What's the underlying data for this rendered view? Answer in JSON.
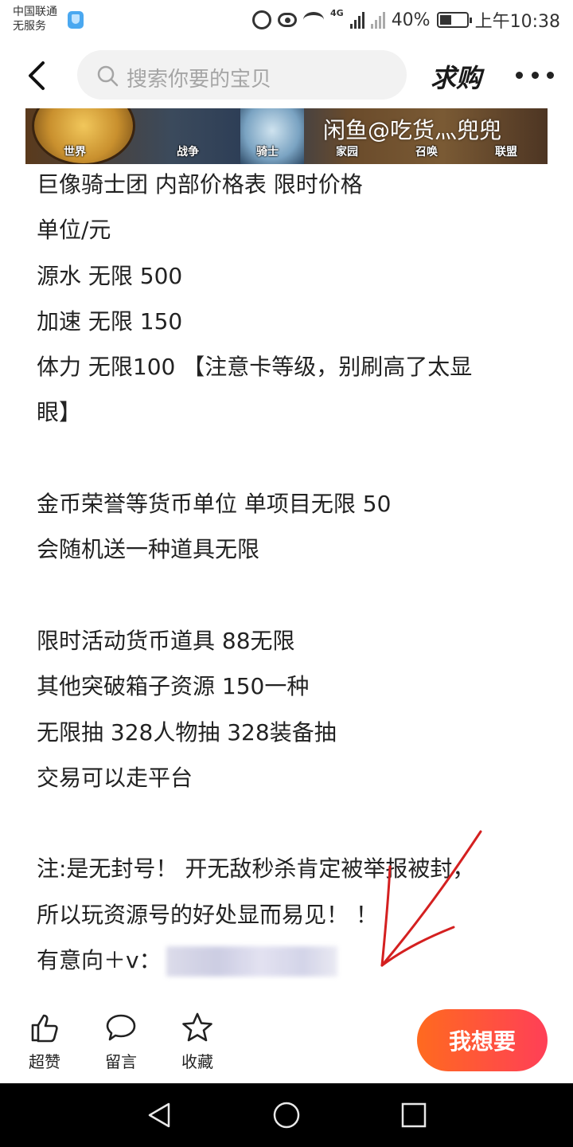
{
  "status_bar": {
    "carrier_line1": "中国联通",
    "carrier_line2": "无服务",
    "network": "4G",
    "battery": "40%",
    "time": "上午10:38"
  },
  "nav": {
    "search_placeholder": "搜索你要的宝贝",
    "want_buy_label": "求购"
  },
  "banner": {
    "tabs": [
      "世界",
      "战争",
      "骑士",
      "家园",
      "召唤",
      "联盟"
    ],
    "watermark": "闲鱼@吃货灬兜兜"
  },
  "post": {
    "lines": [
      "巨像骑士团  内部价格表  限时价格",
      "单位/元",
      "源水  无限  500",
      "加速 无限 150",
      "体力 无限100 【注意卡等级，别刷高了太显",
      "眼】",
      "",
      "金币荣誉等货币单位   单项目无限 50",
      "会随机送一种道具无限",
      "",
      "限时活动货币道具 88无限",
      "其他突破箱子资源  150一种",
      "无限抽  328人物抽  328装备抽",
      "交易可以走平台",
      "",
      "注:是无封号！ 开无敌秒杀肯定被举报被封，",
      "所以玩资源号的好处显而易见！ ！"
    ],
    "contact_prefix": "有意向＋v："
  },
  "actions": {
    "like_label": "超赞",
    "comment_label": "留言",
    "favorite_label": "收藏",
    "want_label": "我想要"
  },
  "colors": {
    "want_button_start": "#ff6a1f",
    "want_button_end": "#ff3f57",
    "annotation_arrow": "#d42020"
  }
}
